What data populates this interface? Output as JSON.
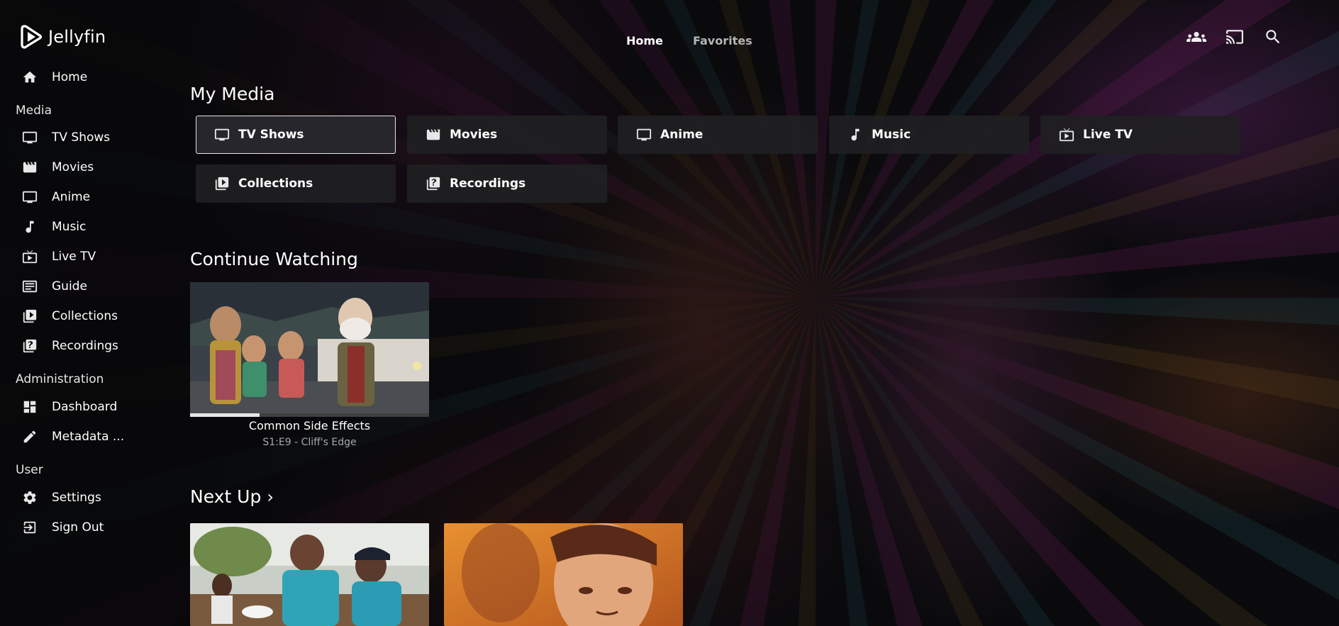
{
  "app": {
    "name": "Jellyfin"
  },
  "header": {
    "tabs": [
      {
        "label": "Home",
        "active": true
      },
      {
        "label": "Favorites",
        "active": false
      }
    ],
    "icons": [
      "users-icon",
      "cast-icon",
      "search-icon"
    ]
  },
  "sidebar": {
    "home": "Home",
    "sections": {
      "media": "Media",
      "administration": "Administration",
      "user": "User"
    },
    "media_items": [
      {
        "label": "TV Shows",
        "icon": "tv-icon"
      },
      {
        "label": "Movies",
        "icon": "movie-icon"
      },
      {
        "label": "Anime",
        "icon": "tv-icon"
      },
      {
        "label": "Music",
        "icon": "music-note-icon"
      },
      {
        "label": "Live TV",
        "icon": "live-tv-icon"
      },
      {
        "label": "Guide",
        "icon": "guide-icon"
      },
      {
        "label": "Collections",
        "icon": "collections-icon"
      },
      {
        "label": "Recordings",
        "icon": "recordings-icon"
      }
    ],
    "admin_items": [
      {
        "label": "Dashboard",
        "icon": "dashboard-icon"
      },
      {
        "label": "Metadata ...",
        "icon": "pencil-icon"
      }
    ],
    "user_items": [
      {
        "label": "Settings",
        "icon": "gear-icon"
      },
      {
        "label": "Sign Out",
        "icon": "sign-out-icon"
      }
    ]
  },
  "main": {
    "my_media": {
      "title": "My Media",
      "tiles": [
        {
          "label": "TV Shows",
          "icon": "tv-icon",
          "selected": true
        },
        {
          "label": "Movies",
          "icon": "movie-icon",
          "selected": false
        },
        {
          "label": "Anime",
          "icon": "tv-icon",
          "selected": false
        },
        {
          "label": "Music",
          "icon": "music-note-icon",
          "selected": false
        },
        {
          "label": "Live TV",
          "icon": "live-tv-icon",
          "selected": false
        },
        {
          "label": "Collections",
          "icon": "collections-icon",
          "selected": false
        },
        {
          "label": "Recordings",
          "icon": "recordings-icon",
          "selected": false
        }
      ]
    },
    "continue_watching": {
      "title": "Continue Watching",
      "items": [
        {
          "title": "Common Side Effects",
          "subtitle": "S1:E9 - Cliff's Edge",
          "progress": 0.29
        }
      ]
    },
    "next_up": {
      "title": "Next Up",
      "chevron": "›",
      "items": [
        {
          "thumbnail": "people-at-table"
        },
        {
          "thumbnail": "orange-animated-face"
        }
      ]
    }
  },
  "colors": {
    "accent": "#ffffff",
    "tile_bg": "#202022",
    "muted_text": "#a8a8a8"
  }
}
